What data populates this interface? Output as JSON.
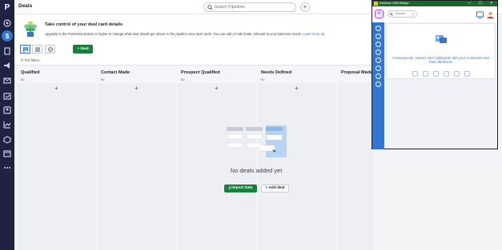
{
  "header": {
    "page_title": "Deals",
    "search_placeholder": "Search Pipedrive",
    "add_label": "+"
  },
  "nav": {
    "logo": "P",
    "icons": [
      "target-icon",
      "deals-icon",
      "leads-icon",
      "projects-icon",
      "campaigns-icon",
      "mail-icon",
      "activities-icon",
      "contacts-icon",
      "insights-icon",
      "products-icon",
      "marketplace-icon",
      "more-icon"
    ]
  },
  "banner": {
    "title": "Take control of your deal card details",
    "body": "Upgrade to the Professional plan or higher to change what deal details get shown in the pipeline view deal cards. You can add or hide fields, relevant to your business needs.",
    "link": "Learn more ab"
  },
  "toolbar": {
    "deal_button": "+ Deal"
  },
  "filter": {
    "pin_label": "Pin filters"
  },
  "pipeline": {
    "stages": [
      {
        "name": "Qualified",
        "value": "$0"
      },
      {
        "name": "Contact Made",
        "value": "$0"
      },
      {
        "name": "Prospect Qualified",
        "value": "$0"
      },
      {
        "name": "Needs Defined",
        "value": "$0"
      },
      {
        "name": "Proposal Made",
        "value": ""
      }
    ],
    "add_symbol": "+"
  },
  "empty_state": {
    "message": "No deals added yet",
    "import_label": "Import data",
    "add_deal_label": "+ Add deal"
  },
  "rainbow": {
    "window_title": "Rainbow CRM Bridge",
    "controls": [
      "—",
      "☐",
      "✕"
    ],
    "search_placeholder": "People...",
    "clear": "✕",
    "tagline": "Communicate, Interact and Collaborate with your Customers and Team Members!"
  },
  "colors": {
    "nav_bg": "#1e2344",
    "accent": "#2e77d6",
    "primary_green": "#1a7f3c",
    "rainbow_titlebar": "#1b6a2b"
  }
}
